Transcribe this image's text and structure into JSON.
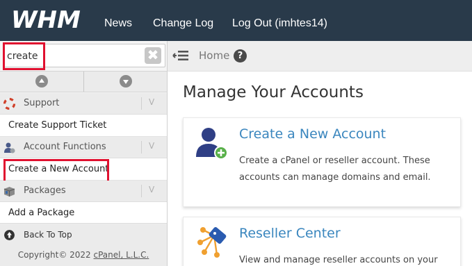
{
  "header": {
    "logo_text": "WHM",
    "nav": [
      {
        "label": "News"
      },
      {
        "label": "Change Log"
      },
      {
        "label": "Log Out (imhtes14)"
      }
    ]
  },
  "search": {
    "value": "create",
    "clear_glyph": "✖"
  },
  "sidebar": {
    "categories": [
      {
        "label": "Support",
        "icon": "lifebuoy-icon",
        "chevron": "V",
        "items": [
          {
            "label": "Create Support Ticket"
          }
        ]
      },
      {
        "label": "Account Functions",
        "icon": "user-icon",
        "chevron": "V",
        "items": [
          {
            "label": "Create a New Account"
          }
        ]
      },
      {
        "label": "Packages",
        "icon": "package-icon",
        "chevron": "V",
        "items": [
          {
            "label": "Add a Package"
          }
        ]
      }
    ],
    "back_to_top": "Back To Top",
    "copyright_prefix": "Copyright© 2022 ",
    "copyright_link": "cPanel, L.L.C."
  },
  "breadcrumb": {
    "home": "Home",
    "help_glyph": "?"
  },
  "main": {
    "title": "Manage Your Accounts",
    "cards": [
      {
        "title": "Create a New Account",
        "description": "Create a cPanel or reseller account. These accounts can manage domains and email.",
        "icon": "add-user-icon"
      },
      {
        "title": "Reseller Center",
        "description": "View and manage reseller accounts on your",
        "icon": "reseller-icon"
      }
    ]
  },
  "colors": {
    "topbar": "#293a4a",
    "highlight": "#e0102f",
    "link_blue": "#3a86be"
  }
}
